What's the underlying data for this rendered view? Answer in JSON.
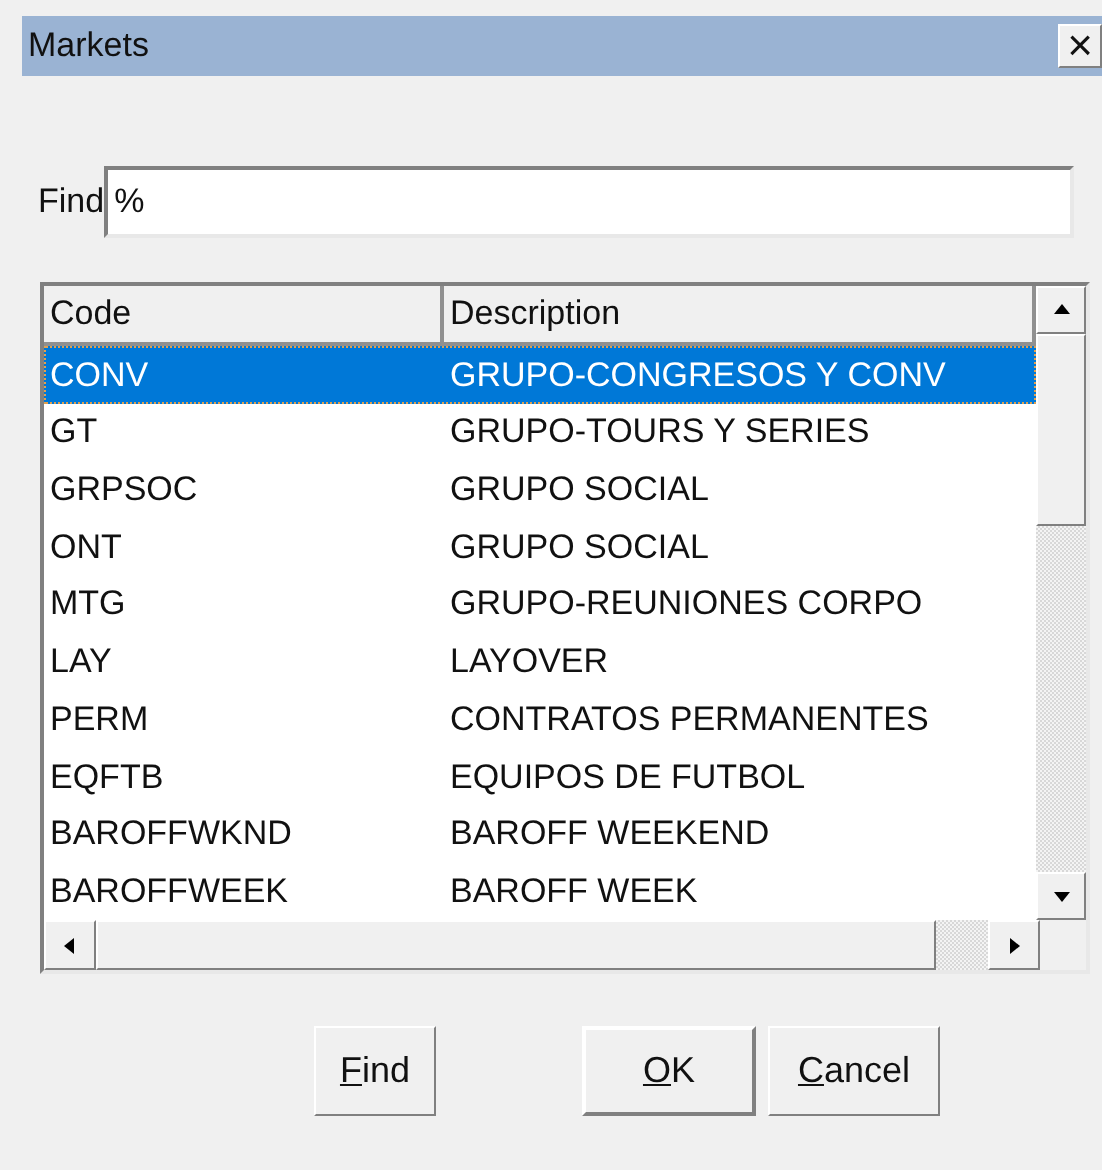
{
  "window": {
    "title": "Markets",
    "close": "×"
  },
  "find": {
    "label": "Find",
    "value": "%"
  },
  "table": {
    "columns": [
      "Code",
      "Description"
    ],
    "rows": [
      {
        "code": "CONV",
        "description": "GRUPO-CONGRESOS Y CONV",
        "selected": true
      },
      {
        "code": "GT",
        "description": "GRUPO-TOURS Y SERIES",
        "selected": false
      },
      {
        "code": "GRPSOC",
        "description": "GRUPO SOCIAL",
        "selected": false
      },
      {
        "code": "ONT",
        "description": "GRUPO SOCIAL",
        "selected": false
      },
      {
        "code": "MTG",
        "description": "GRUPO-REUNIONES CORPO",
        "selected": false
      },
      {
        "code": "LAY",
        "description": "LAYOVER",
        "selected": false
      },
      {
        "code": "PERM",
        "description": "CONTRATOS PERMANENTES",
        "selected": false
      },
      {
        "code": "EQFTB",
        "description": "EQUIPOS DE FUTBOL",
        "selected": false
      },
      {
        "code": "BAROFFWKND",
        "description": "BAROFF WEEKEND",
        "selected": false
      },
      {
        "code": "BAROFFWEEK",
        "description": "BAROFF WEEK",
        "selected": false
      }
    ]
  },
  "buttons": [
    {
      "kind": "find",
      "label": "Find",
      "mnemonic": true
    },
    {
      "kind": "ok",
      "label": "OK",
      "mnemonic": true
    },
    {
      "kind": "cancel",
      "label": "Cancel",
      "mnemonic": true
    }
  ]
}
